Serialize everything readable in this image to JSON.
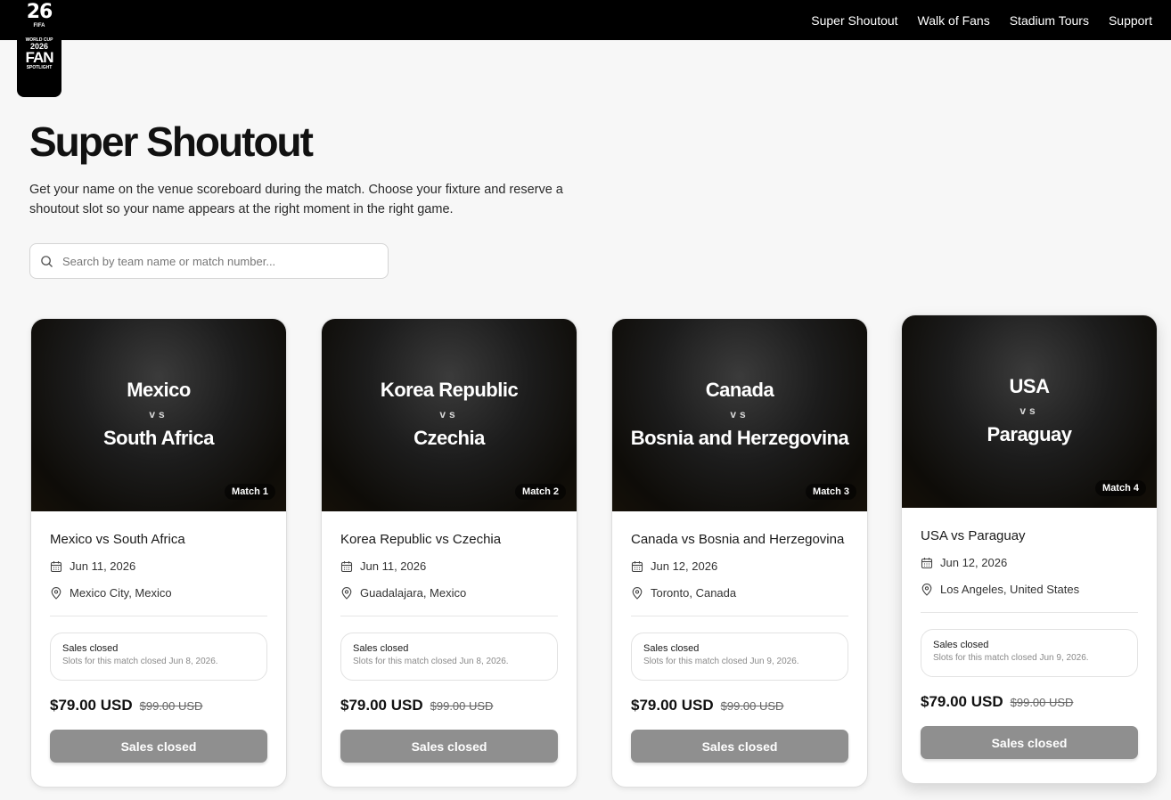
{
  "nav": {
    "items": [
      "Super Shoutout",
      "Walk of Fans",
      "Stadium Tours",
      "Support"
    ]
  },
  "logo": {
    "digits": "26",
    "fifa": "FIFA",
    "world_cup": "WORLD CUP",
    "year": "2026",
    "fan": "FAN",
    "spotlight": "SPOTLIGHT"
  },
  "page": {
    "title": "Super Shoutout",
    "description": "Get your name on the venue scoreboard during the match. Choose your fixture and reserve a shoutout slot so your name appears at the right moment in the right game."
  },
  "search": {
    "placeholder": "Search by team name or match number..."
  },
  "cards": [
    {
      "team_a": "Mexico",
      "vs": "vs",
      "team_b": "South Africa",
      "badge": "Match 1",
      "match_name": "Mexico vs South Africa",
      "date": "Jun 11, 2026",
      "location": "Mexico City, Mexico",
      "status_title": "Sales closed",
      "status_detail": "Slots for this match closed Jun 8, 2026.",
      "price": "$79.00 USD",
      "old_price": "$99.00 USD",
      "button": "Sales closed"
    },
    {
      "team_a": "Korea Republic",
      "vs": "vs",
      "team_b": "Czechia",
      "badge": "Match 2",
      "match_name": "Korea Republic vs Czechia",
      "date": "Jun 11, 2026",
      "location": "Guadalajara, Mexico",
      "status_title": "Sales closed",
      "status_detail": "Slots for this match closed Jun 8, 2026.",
      "price": "$79.00 USD",
      "old_price": "$99.00 USD",
      "button": "Sales closed"
    },
    {
      "team_a": "Canada",
      "vs": "vs",
      "team_b": "Bosnia and Herzegovina",
      "badge": "Match 3",
      "match_name": "Canada vs Bosnia and Herzegovina",
      "date": "Jun 12, 2026",
      "location": "Toronto, Canada",
      "status_title": "Sales closed",
      "status_detail": "Slots for this match closed Jun 9, 2026.",
      "price": "$79.00 USD",
      "old_price": "$99.00 USD",
      "button": "Sales closed"
    },
    {
      "team_a": "USA",
      "vs": "vs",
      "team_b": "Paraguay",
      "badge": "Match 4",
      "match_name": "USA vs Paraguay",
      "date": "Jun 12, 2026",
      "location": "Los Angeles, United States",
      "status_title": "Sales closed",
      "status_detail": "Slots for this match closed Jun 9, 2026.",
      "price": "$79.00 USD",
      "old_price": "$99.00 USD",
      "button": "Sales closed"
    }
  ]
}
